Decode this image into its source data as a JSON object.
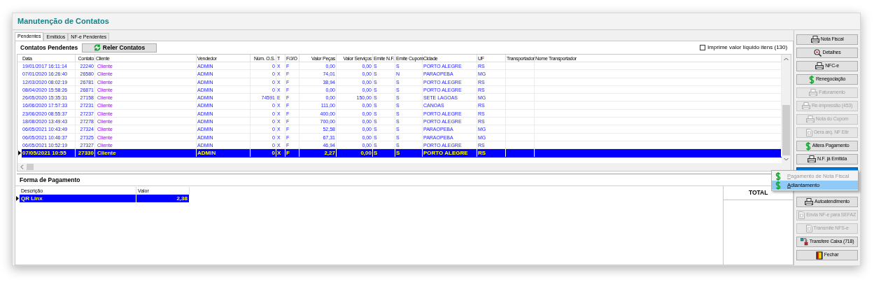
{
  "window": {
    "title": "Manutenção de Contatos"
  },
  "tabs": [
    {
      "label": "Pendentes",
      "selected": true
    },
    {
      "label": "Emitidos",
      "selected": false
    },
    {
      "label": "NF-e Pendentes",
      "selected": false
    }
  ],
  "contacts": {
    "title": "Contatos Pendentes",
    "reload_button": "Reler Contatos",
    "print_net": {
      "label": "Imprime valor líquido itens (130)",
      "checked": false
    },
    "columns": [
      "Data",
      "Contato",
      "Cliente",
      "Vendedor",
      "Núm. O.S.",
      "T",
      "F/J/O",
      "Valor Peças",
      "Valor Serviços",
      "Emite N.F.",
      "Emite Cupom",
      "Cidade",
      "UF",
      "Transportador",
      "Nome Transportador"
    ],
    "rows": [
      {
        "selected": false,
        "cells": [
          "19/01/2017 16:11:14",
          "22240",
          "Cliente",
          "ADMIN",
          "0",
          "X",
          "F",
          "0,00",
          "0,00",
          "S",
          "S",
          "PORTO ALEGRE",
          "RS",
          "",
          ""
        ]
      },
      {
        "selected": false,
        "cells": [
          "07/01/2020 16:26:40",
          "26580",
          "Cliente",
          "ADMIN",
          "0",
          "X",
          "F",
          "74,01",
          "0,00",
          "S",
          "N",
          "PARAOPEBA",
          "MG",
          "",
          ""
        ]
      },
      {
        "selected": false,
        "cells": [
          "12/03/2020 08:02:19",
          "26781",
          "Cliente",
          "ADMIN",
          "0",
          "X",
          "F",
          "38,94",
          "0,00",
          "S",
          "S",
          "PORTO ALEGRE",
          "RS",
          "",
          ""
        ]
      },
      {
        "selected": false,
        "cells": [
          "08/04/2020 15:58:26",
          "26871",
          "Cliente",
          "ADMIN",
          "0",
          "X",
          "F",
          "0,00",
          "0,00",
          "S",
          "S",
          "PORTO ALEGRE",
          "RS",
          "",
          ""
        ]
      },
      {
        "selected": false,
        "cells": [
          "26/05/2020 15:35:31",
          "27158",
          "Cliente",
          "ADMIN",
          "74591",
          "E",
          "F",
          "0,00",
          "150,00",
          "S",
          "S",
          "SETE LAGOAS",
          "MG",
          "",
          ""
        ]
      },
      {
        "selected": false,
        "cells": [
          "16/06/2020 17:57:33",
          "27231",
          "Cliente",
          "ADMIN",
          "0",
          "X",
          "F",
          "111,00",
          "0,00",
          "S",
          "S",
          "CANOAS",
          "RS",
          "",
          ""
        ]
      },
      {
        "selected": false,
        "cells": [
          "23/06/2020 08:55:37",
          "27237",
          "Cliente",
          "ADMIN",
          "0",
          "X",
          "F",
          "400,00",
          "0,00",
          "S",
          "S",
          "PORTO ALEGRE",
          "RS",
          "",
          ""
        ]
      },
      {
        "selected": false,
        "cells": [
          "18/08/2020 13:49:43",
          "27278",
          "Cliente",
          "ADMIN",
          "0",
          "X",
          "F",
          "700,00",
          "0,00",
          "S",
          "S",
          "PORTO ALEGRE",
          "RS",
          "",
          ""
        ]
      },
      {
        "selected": false,
        "cells": [
          "06/05/2021 10:43:49",
          "27324",
          "Cliente",
          "ADMIN",
          "0",
          "X",
          "F",
          "52,58",
          "0,00",
          "S",
          "S",
          "PARAOPEBA",
          "MG",
          "",
          ""
        ]
      },
      {
        "selected": false,
        "cells": [
          "06/05/2021 10:46:37",
          "27325",
          "Cliente",
          "ADMIN",
          "0",
          "X",
          "F",
          "67,31",
          "0,00",
          "S",
          "S",
          "PARAOPEBA",
          "MG",
          "",
          ""
        ]
      },
      {
        "selected": false,
        "cells": [
          "06/05/2021 10:52:19",
          "27327",
          "Cliente",
          "ADMIN",
          "0",
          "X",
          "F",
          "46,94",
          "0,00",
          "S",
          "S",
          "PORTO ALEGRE",
          "RS",
          "",
          ""
        ]
      },
      {
        "selected": true,
        "cells": [
          "07/05/2021 10:55",
          "27330",
          "Cliente",
          "ADMIN",
          "0",
          "X",
          "F",
          "2,27",
          "0,00",
          "S",
          "S",
          "PORTO ALEGRE",
          "RS",
          "",
          ""
        ]
      }
    ]
  },
  "payment": {
    "title": "Forma de Pagamento",
    "columns": [
      "Descrição",
      "Valor"
    ],
    "rows": [
      {
        "selected": true,
        "cells": [
          "QR Linx",
          "2,38"
        ]
      }
    ],
    "total_label": "TOTAL"
  },
  "buttons": [
    {
      "label": "Nota Fiscal",
      "kind": "printer",
      "disabled": false,
      "selected": false
    },
    {
      "label": "Detalhes",
      "kind": "magnifier",
      "disabled": false,
      "selected": false
    },
    {
      "label": "NFC-e",
      "kind": "printer",
      "disabled": false,
      "selected": false
    },
    {
      "label": "Renegociação",
      "kind": "dollar",
      "disabled": false,
      "selected": false
    },
    {
      "label": "Faturamento",
      "kind": "printer",
      "disabled": true,
      "selected": false
    },
    {
      "label": "Re-impressão (453)",
      "kind": "printer",
      "disabled": true,
      "selected": false
    },
    {
      "label": "Nota do Cupom",
      "kind": "printer",
      "disabled": true,
      "selected": false
    },
    {
      "label": "Gera arq. NF Eltr",
      "kind": "document",
      "disabled": true,
      "selected": false
    },
    {
      "label": "Altera Pagamento",
      "kind": "dollar",
      "disabled": false,
      "selected": false
    },
    {
      "label": "N.F. já Emitida",
      "kind": "printer",
      "disabled": false,
      "selected": false
    },
    {
      "kind": "blank",
      "disabled": false,
      "selected": true
    },
    {
      "label": "Autoatendimento",
      "kind": "printer",
      "disabled": false,
      "selected": false
    },
    {
      "label": "Envia NF-e para SEFAZ",
      "kind": "document",
      "disabled": true,
      "selected": false
    },
    {
      "label": "Transmite NFS-e",
      "kind": "document",
      "disabled": true,
      "selected": false
    },
    {
      "label": "Transfere Caixa (718)",
      "kind": "transfer",
      "disabled": false,
      "selected": false
    },
    {
      "label": "Fechar",
      "kind": "door",
      "disabled": false,
      "selected": false
    }
  ],
  "popup_menu": [
    {
      "label": "Pagamento de Nota Fiscal",
      "disabled": true,
      "selected": false
    },
    {
      "label": "Adiantamento",
      "disabled": false,
      "selected": true
    }
  ]
}
